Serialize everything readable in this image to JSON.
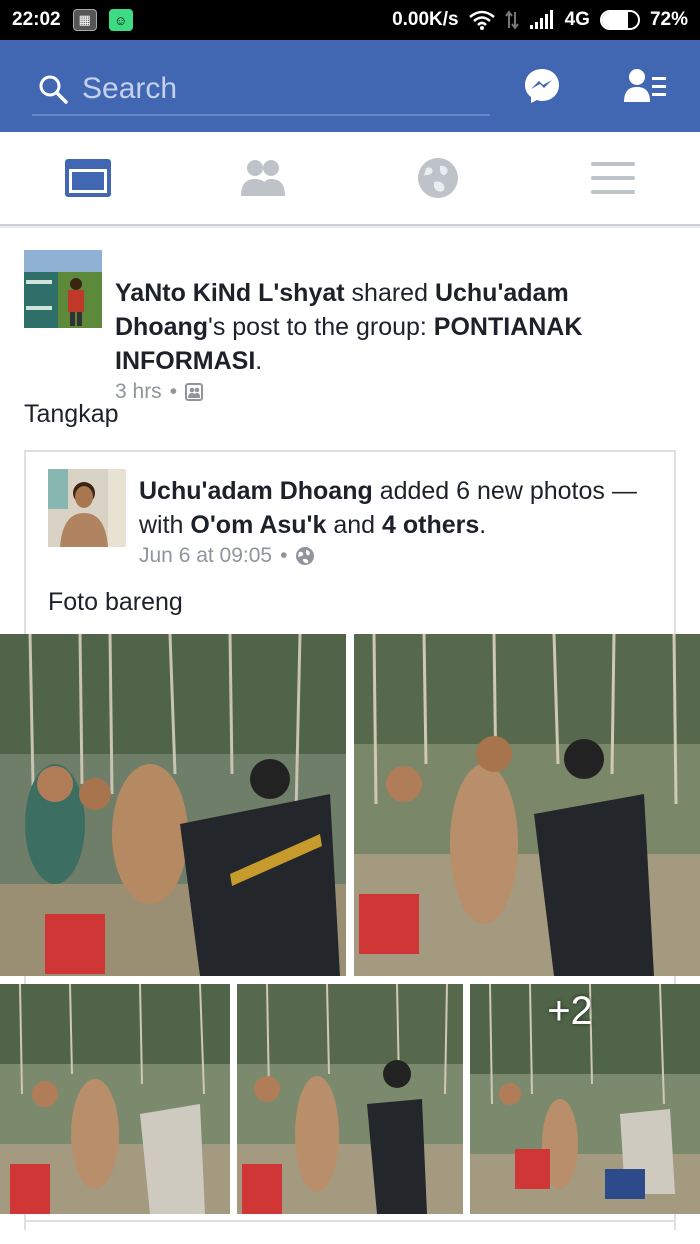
{
  "status_bar": {
    "time": "22:02",
    "network_speed": "0.00K/s",
    "network_type": "4G",
    "battery": "72%",
    "battery_level": 0.72
  },
  "topbar": {
    "search_placeholder": "Search",
    "icons": [
      "search-icon",
      "messenger-icon",
      "friend-requests-icon"
    ]
  },
  "nav_tabs": [
    {
      "name": "news-feed",
      "active": true
    },
    {
      "name": "friends",
      "active": false
    },
    {
      "name": "notifications-globe",
      "active": false
    },
    {
      "name": "menu",
      "active": false
    }
  ],
  "post": {
    "author": "YaNto KiNd L'shyat",
    "verb": " shared ",
    "original_author": "Uchu'adam Dhoang",
    "post_to_text": "'s post to the group: ",
    "group": "PONTIANAK INFORMASI",
    "suffix": ".",
    "time": "3 hrs",
    "dot": "•",
    "body": "Tangkap"
  },
  "shared_post": {
    "author": "Uchu'adam Dhoang",
    "action": " added 6 new photos — with ",
    "tagged1": "O'om Asu'k",
    "and": " and ",
    "others": "4 others",
    "suffix": ".",
    "time": "Jun 6 at 09:05",
    "dot": "•",
    "body": "Foto bareng",
    "more_photos": "+2"
  },
  "colors": {
    "facebook_blue": "#4267b2",
    "active_tab": "#4267b2",
    "inactive_tab": "#bec2c9",
    "meta_text": "#90949c"
  }
}
